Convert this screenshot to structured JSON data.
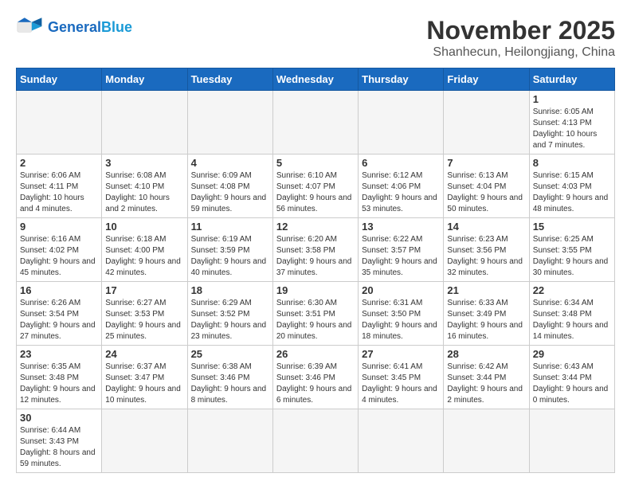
{
  "header": {
    "logo_general": "General",
    "logo_blue": "Blue",
    "month_year": "November 2025",
    "location": "Shanhecun, Heilongjiang, China"
  },
  "weekdays": [
    "Sunday",
    "Monday",
    "Tuesday",
    "Wednesday",
    "Thursday",
    "Friday",
    "Saturday"
  ],
  "days": [
    {
      "num": "",
      "info": ""
    },
    {
      "num": "",
      "info": ""
    },
    {
      "num": "",
      "info": ""
    },
    {
      "num": "",
      "info": ""
    },
    {
      "num": "",
      "info": ""
    },
    {
      "num": "",
      "info": ""
    },
    {
      "num": "1",
      "info": "Sunrise: 6:05 AM\nSunset: 4:13 PM\nDaylight: 10 hours and 7 minutes."
    },
    {
      "num": "2",
      "info": "Sunrise: 6:06 AM\nSunset: 4:11 PM\nDaylight: 10 hours and 4 minutes."
    },
    {
      "num": "3",
      "info": "Sunrise: 6:08 AM\nSunset: 4:10 PM\nDaylight: 10 hours and 2 minutes."
    },
    {
      "num": "4",
      "info": "Sunrise: 6:09 AM\nSunset: 4:08 PM\nDaylight: 9 hours and 59 minutes."
    },
    {
      "num": "5",
      "info": "Sunrise: 6:10 AM\nSunset: 4:07 PM\nDaylight: 9 hours and 56 minutes."
    },
    {
      "num": "6",
      "info": "Sunrise: 6:12 AM\nSunset: 4:06 PM\nDaylight: 9 hours and 53 minutes."
    },
    {
      "num": "7",
      "info": "Sunrise: 6:13 AM\nSunset: 4:04 PM\nDaylight: 9 hours and 50 minutes."
    },
    {
      "num": "8",
      "info": "Sunrise: 6:15 AM\nSunset: 4:03 PM\nDaylight: 9 hours and 48 minutes."
    },
    {
      "num": "9",
      "info": "Sunrise: 6:16 AM\nSunset: 4:02 PM\nDaylight: 9 hours and 45 minutes."
    },
    {
      "num": "10",
      "info": "Sunrise: 6:18 AM\nSunset: 4:00 PM\nDaylight: 9 hours and 42 minutes."
    },
    {
      "num": "11",
      "info": "Sunrise: 6:19 AM\nSunset: 3:59 PM\nDaylight: 9 hours and 40 minutes."
    },
    {
      "num": "12",
      "info": "Sunrise: 6:20 AM\nSunset: 3:58 PM\nDaylight: 9 hours and 37 minutes."
    },
    {
      "num": "13",
      "info": "Sunrise: 6:22 AM\nSunset: 3:57 PM\nDaylight: 9 hours and 35 minutes."
    },
    {
      "num": "14",
      "info": "Sunrise: 6:23 AM\nSunset: 3:56 PM\nDaylight: 9 hours and 32 minutes."
    },
    {
      "num": "15",
      "info": "Sunrise: 6:25 AM\nSunset: 3:55 PM\nDaylight: 9 hours and 30 minutes."
    },
    {
      "num": "16",
      "info": "Sunrise: 6:26 AM\nSunset: 3:54 PM\nDaylight: 9 hours and 27 minutes."
    },
    {
      "num": "17",
      "info": "Sunrise: 6:27 AM\nSunset: 3:53 PM\nDaylight: 9 hours and 25 minutes."
    },
    {
      "num": "18",
      "info": "Sunrise: 6:29 AM\nSunset: 3:52 PM\nDaylight: 9 hours and 23 minutes."
    },
    {
      "num": "19",
      "info": "Sunrise: 6:30 AM\nSunset: 3:51 PM\nDaylight: 9 hours and 20 minutes."
    },
    {
      "num": "20",
      "info": "Sunrise: 6:31 AM\nSunset: 3:50 PM\nDaylight: 9 hours and 18 minutes."
    },
    {
      "num": "21",
      "info": "Sunrise: 6:33 AM\nSunset: 3:49 PM\nDaylight: 9 hours and 16 minutes."
    },
    {
      "num": "22",
      "info": "Sunrise: 6:34 AM\nSunset: 3:48 PM\nDaylight: 9 hours and 14 minutes."
    },
    {
      "num": "23",
      "info": "Sunrise: 6:35 AM\nSunset: 3:48 PM\nDaylight: 9 hours and 12 minutes."
    },
    {
      "num": "24",
      "info": "Sunrise: 6:37 AM\nSunset: 3:47 PM\nDaylight: 9 hours and 10 minutes."
    },
    {
      "num": "25",
      "info": "Sunrise: 6:38 AM\nSunset: 3:46 PM\nDaylight: 9 hours and 8 minutes."
    },
    {
      "num": "26",
      "info": "Sunrise: 6:39 AM\nSunset: 3:46 PM\nDaylight: 9 hours and 6 minutes."
    },
    {
      "num": "27",
      "info": "Sunrise: 6:41 AM\nSunset: 3:45 PM\nDaylight: 9 hours and 4 minutes."
    },
    {
      "num": "28",
      "info": "Sunrise: 6:42 AM\nSunset: 3:44 PM\nDaylight: 9 hours and 2 minutes."
    },
    {
      "num": "29",
      "info": "Sunrise: 6:43 AM\nSunset: 3:44 PM\nDaylight: 9 hours and 0 minutes."
    },
    {
      "num": "30",
      "info": "Sunrise: 6:44 AM\nSunset: 3:43 PM\nDaylight: 8 hours and 59 minutes."
    }
  ]
}
